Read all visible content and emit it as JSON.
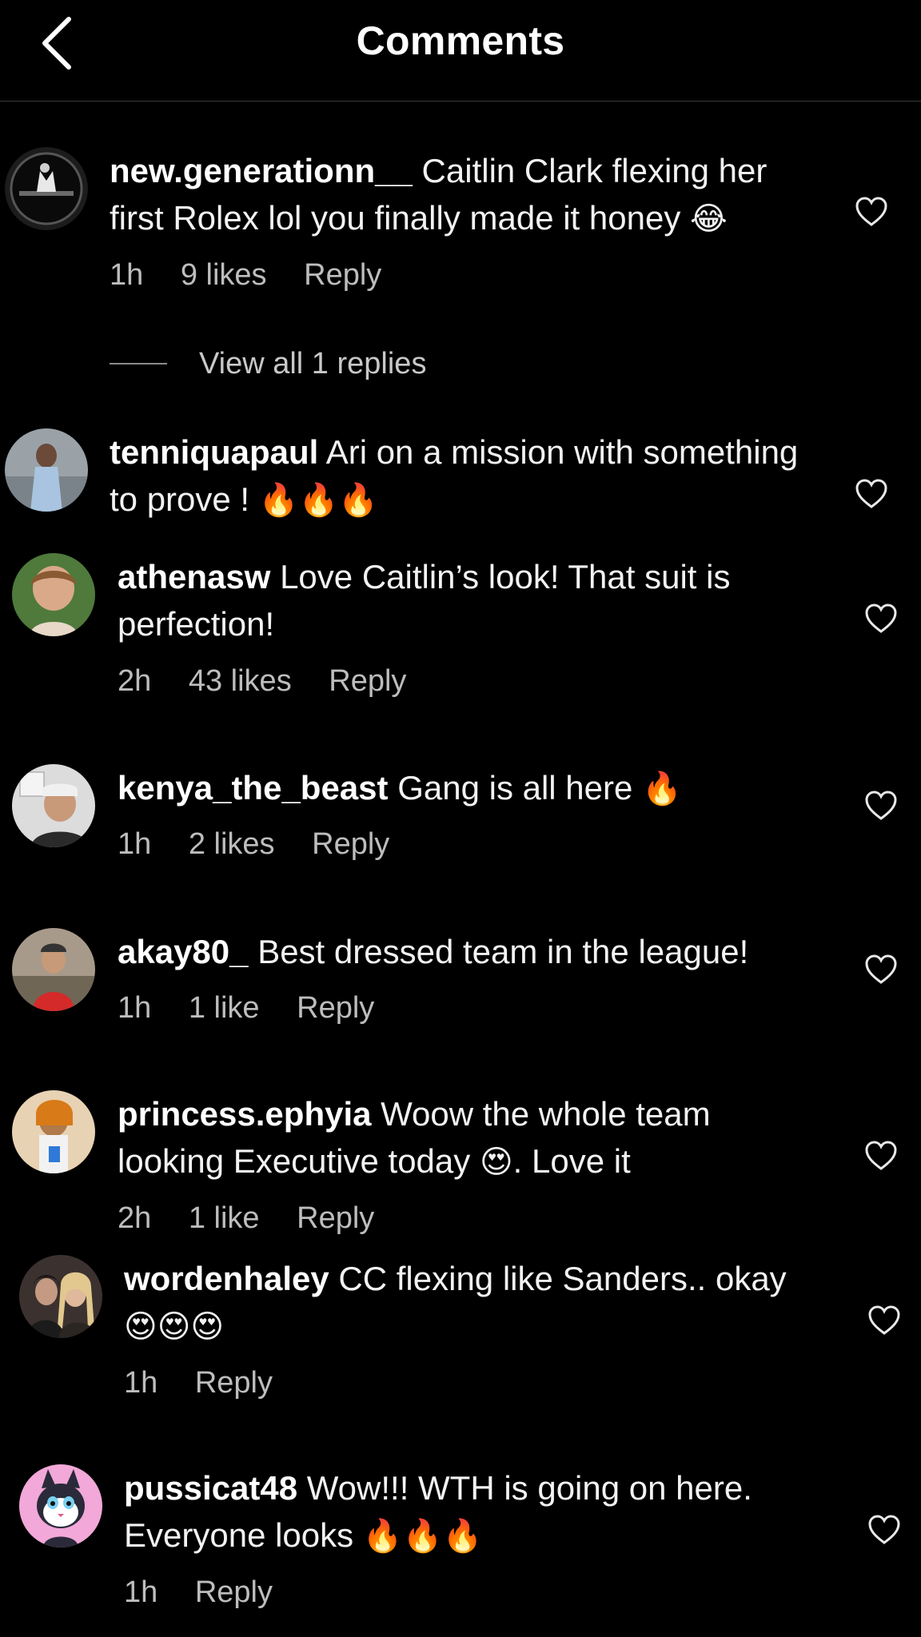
{
  "header": {
    "title": "Comments",
    "back_icon": "chevron-left-icon"
  },
  "comments": [
    {
      "username": "new.generationn__",
      "text": "Caitlin Clark flexing her first Rolex lol you finally made it honey",
      "emoji": "😂",
      "time": "1h",
      "likes": "9 likes",
      "reply": "Reply",
      "avatar_icon": "logo-avatar"
    },
    {
      "username": "tenniquapaul",
      "text": "Ari on a mission with something to prove !",
      "emoji": "🔥🔥🔥",
      "avatar_icon": "person-avatar"
    },
    {
      "username": "athenasw",
      "text": "Love Caitlin’s look! That suit is perfection!",
      "time": "2h",
      "likes": "43 likes",
      "reply": "Reply",
      "avatar_icon": "person-avatar"
    },
    {
      "username": "kenya_the_beast",
      "text": "Gang is all here",
      "emoji": "🔥",
      "time": "1h",
      "likes": "2 likes",
      "reply": "Reply",
      "avatar_icon": "person-avatar"
    },
    {
      "username": "akay80_",
      "text": "Best dressed team in the league!",
      "time": "1h",
      "likes": "1 like",
      "reply": "Reply",
      "avatar_icon": "person-avatar"
    },
    {
      "username": "princess.ephyia",
      "text": "Woow the whole team looking Executive today",
      "emoji": "😍",
      "text_after": ". Love it",
      "time": "2h",
      "likes": "1 like",
      "reply": "Reply",
      "avatar_icon": "person-avatar"
    },
    {
      "username": "wordenhaley",
      "text": "CC flexing like Sanders.. okay",
      "emoji": "😍😍😍",
      "time": "1h",
      "reply": "Reply",
      "avatar_icon": "couple-avatar"
    },
    {
      "username": "pussicat48",
      "text": "Wow!!! WTH is going on here. Everyone looks",
      "emoji": "🔥🔥🔥",
      "time": "1h",
      "reply": "Reply",
      "avatar_icon": "cat-cartoon-avatar"
    }
  ],
  "view_replies": {
    "label": "View all 1 replies"
  },
  "colors": {
    "background": "#000000",
    "text": "#f2f2f2",
    "meta": "#bdbdbd"
  },
  "icons": {
    "like": "heart-icon"
  }
}
